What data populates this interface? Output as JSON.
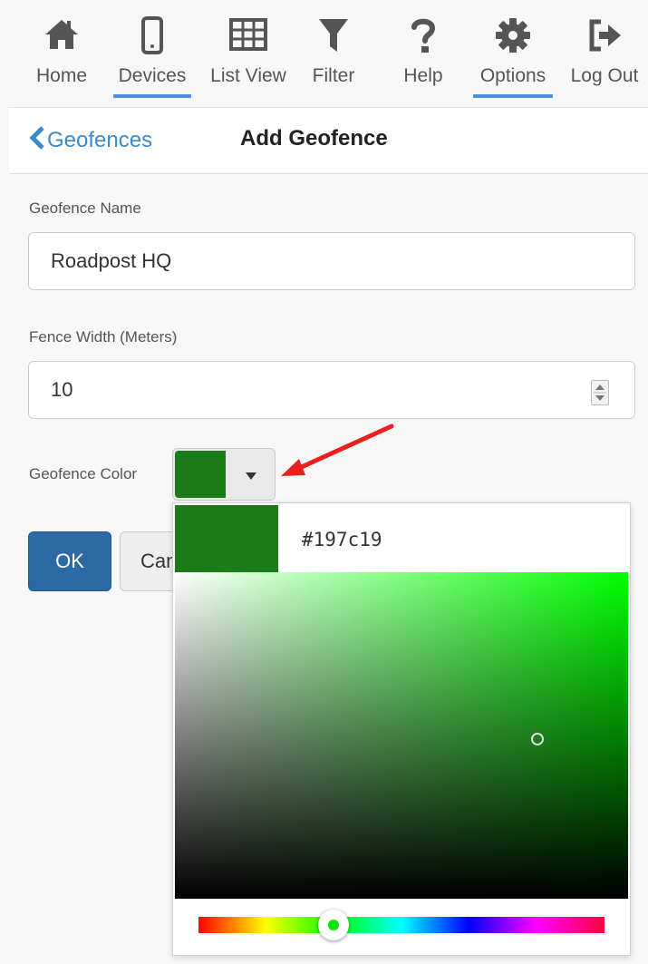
{
  "nav": {
    "items": [
      {
        "label": "Home",
        "icon": "home-icon"
      },
      {
        "label": "Devices",
        "icon": "phone-icon",
        "active": true
      },
      {
        "label": "List View",
        "icon": "grid-icon"
      },
      {
        "label": "Filter",
        "icon": "filter-icon"
      },
      {
        "label": "Help",
        "icon": "question-icon"
      },
      {
        "label": "Options",
        "icon": "gear-icon",
        "active": true
      },
      {
        "label": "Log Out",
        "icon": "logout-icon"
      }
    ]
  },
  "header": {
    "back_label": "Geofences",
    "title": "Add Geofence"
  },
  "form": {
    "name_label": "Geofence Name",
    "name_value": "Roadpost HQ",
    "width_label": "Fence Width (Meters)",
    "width_value": "10",
    "color_label": "Geofence Color",
    "ok_label": "OK",
    "cancel_label": "Cancel"
  },
  "picker": {
    "hex": "#197c19",
    "saturation": 0.8,
    "value": 0.49,
    "hue_degrees": 120
  },
  "colors": {
    "accent": "#3a8ac9",
    "primary_button": "#2b6aa5",
    "selected_color": "#197c19",
    "annotation_arrow": "#e8211f"
  }
}
